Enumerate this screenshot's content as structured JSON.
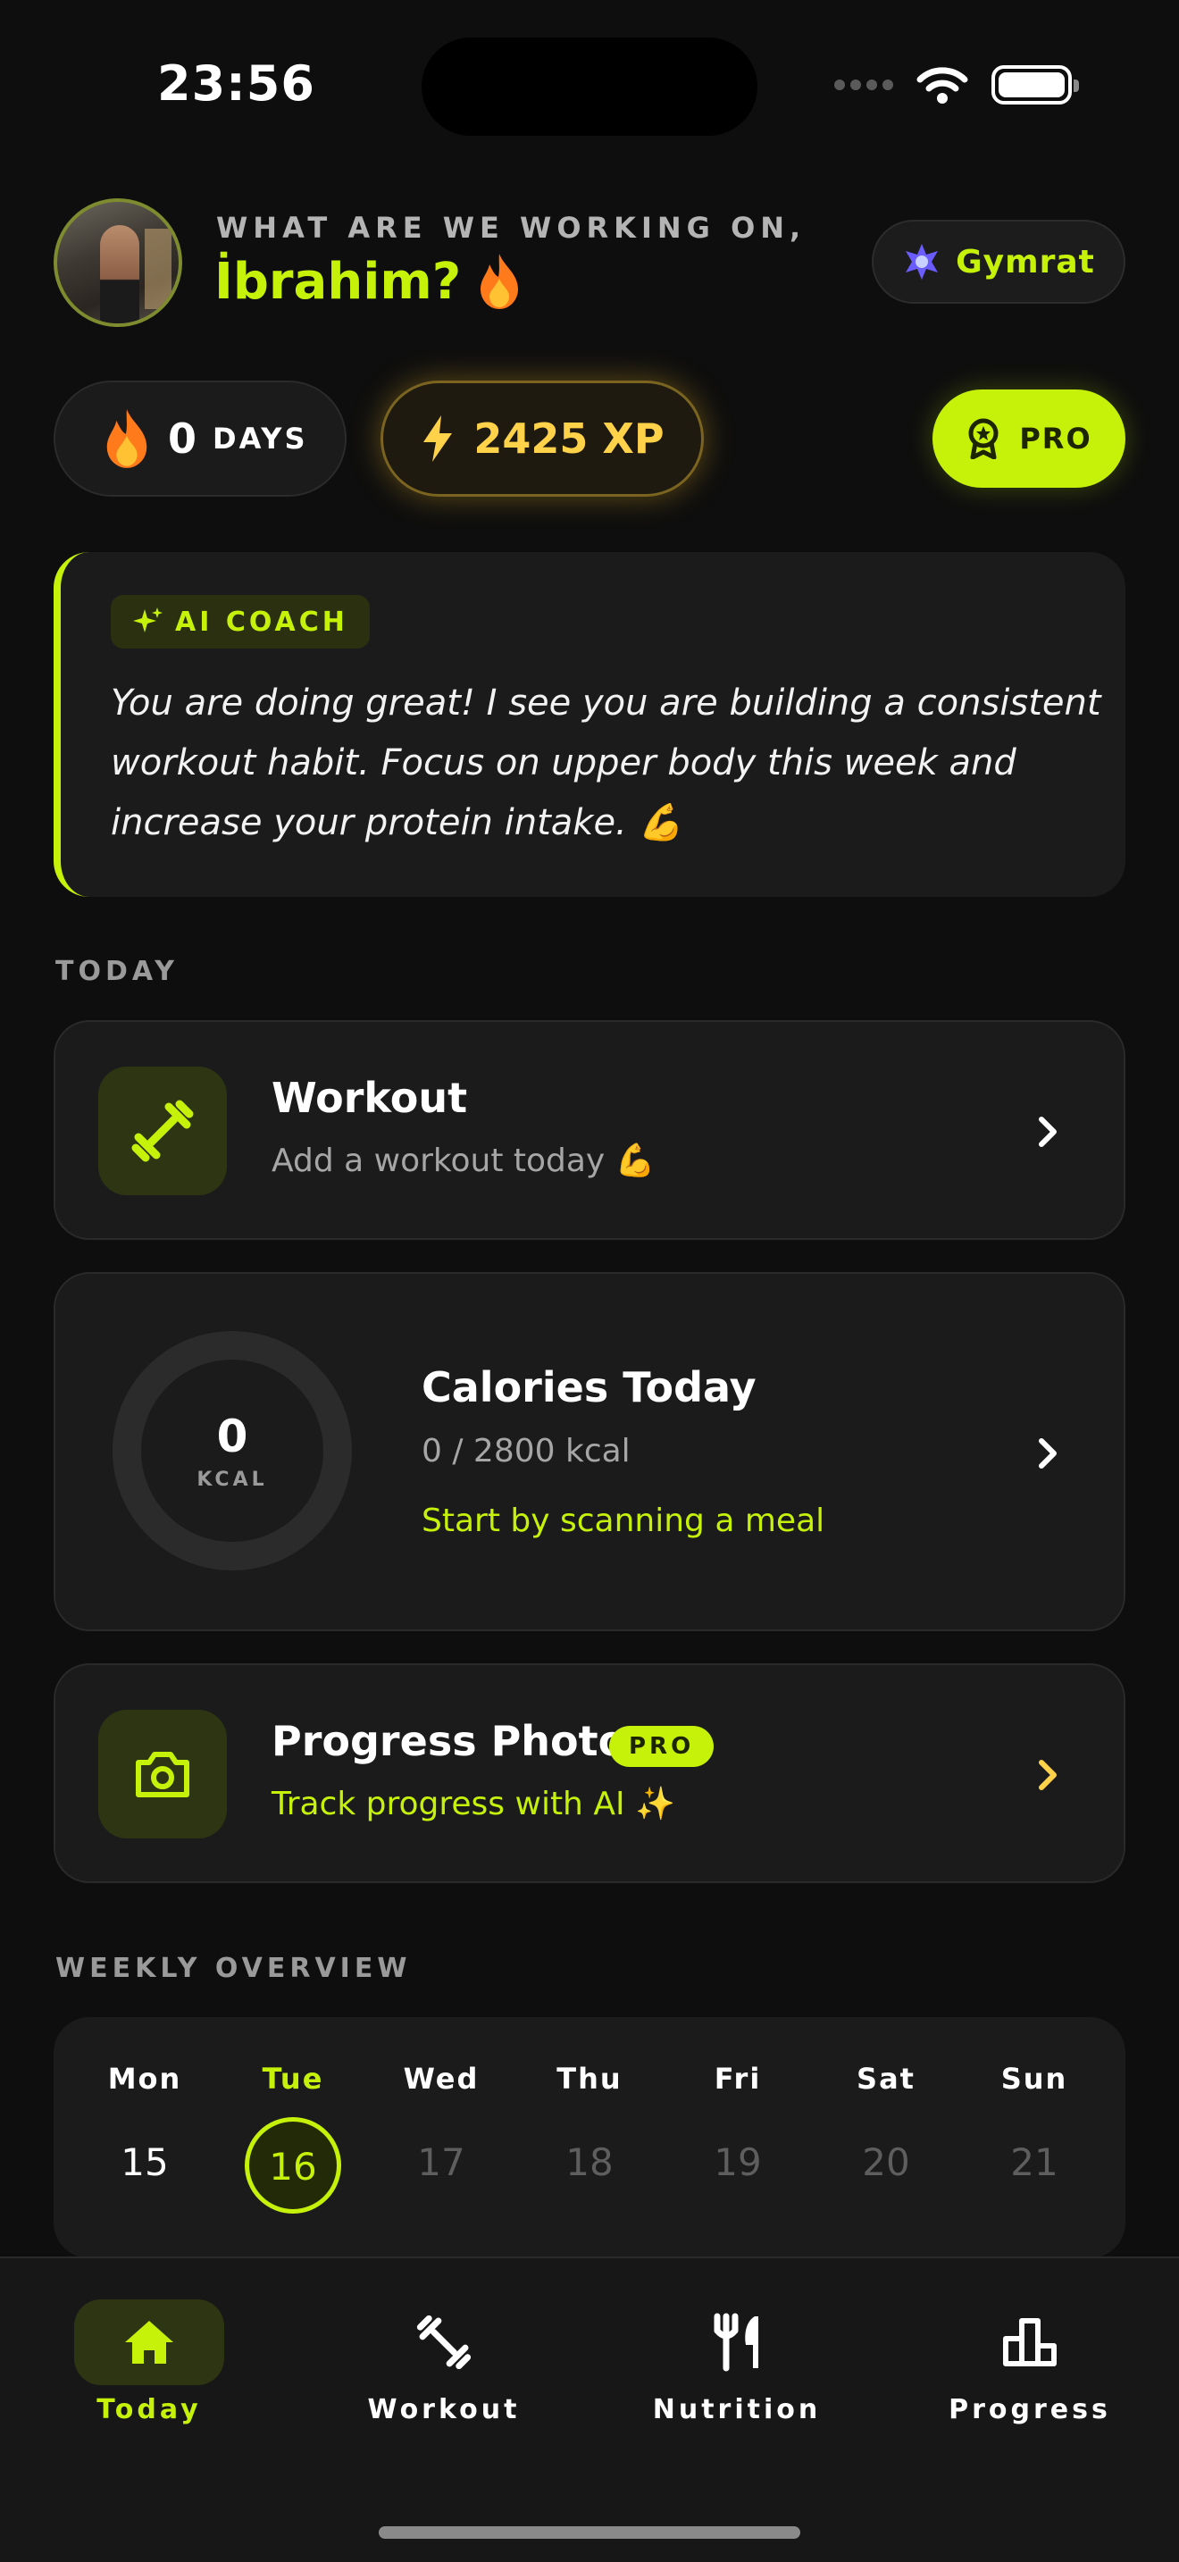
{
  "status_bar": {
    "time": "23:56"
  },
  "header": {
    "greeting": "WHAT ARE WE WORKING ON,",
    "name": "İbrahim?",
    "rank_label": "Gymrat"
  },
  "stats": {
    "streak_value": "0",
    "streak_unit": "DAYS",
    "xp_label": "2425 XP",
    "pro_label": "PRO"
  },
  "ai_coach": {
    "tag": "AI COACH",
    "message": "You are doing great! I see you are building a consistent workout habit. Focus on upper body this week and increase your protein intake. 💪"
  },
  "today": {
    "section_label": "TODAY",
    "workout": {
      "title": "Workout",
      "subtitle": "Add a workout today 💪"
    },
    "calories": {
      "ring_value": "0",
      "ring_unit": "KCAL",
      "title": "Calories Today",
      "summary": "0 / 2800 kcal",
      "hint": "Start by scanning a meal",
      "consumed": 0,
      "goal": 2800
    },
    "progress_photo": {
      "title": "Progress Photo",
      "badge": "PRO",
      "subtitle": "Track progress with AI ✨"
    }
  },
  "weekly": {
    "section_label": "WEEKLY OVERVIEW",
    "days": [
      {
        "name": "Mon",
        "date": "15",
        "state": "past"
      },
      {
        "name": "Tue",
        "date": "16",
        "state": "today"
      },
      {
        "name": "Wed",
        "date": "17",
        "state": "future"
      },
      {
        "name": "Thu",
        "date": "18",
        "state": "future"
      },
      {
        "name": "Fri",
        "date": "19",
        "state": "future"
      },
      {
        "name": "Sat",
        "date": "20",
        "state": "future"
      },
      {
        "name": "Sun",
        "date": "21",
        "state": "future"
      }
    ]
  },
  "tabbar": {
    "tabs": [
      {
        "label": "Today",
        "icon": "home-icon",
        "active": true
      },
      {
        "label": "Workout",
        "icon": "dumbbell-icon",
        "active": false
      },
      {
        "label": "Nutrition",
        "icon": "fork-knife-icon",
        "active": false
      },
      {
        "label": "Progress",
        "icon": "podium-icon",
        "active": false
      }
    ]
  },
  "colors": {
    "accent": "#c6f20a",
    "xp": "#ffd24a",
    "background": "#0e0e0e",
    "card": "#1b1b1b"
  }
}
